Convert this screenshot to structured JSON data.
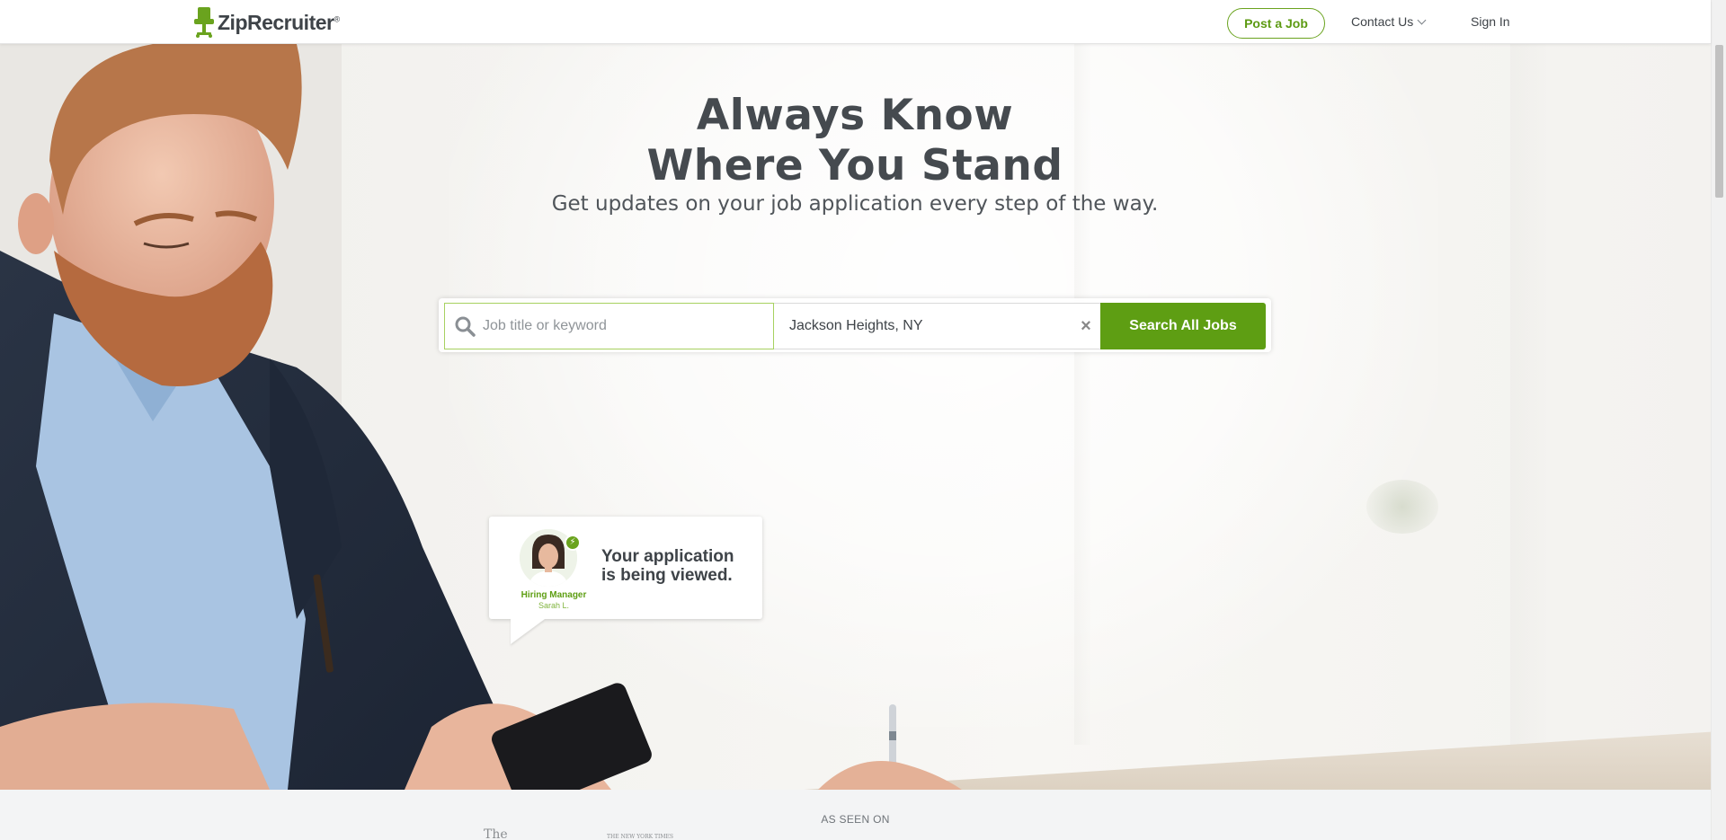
{
  "header": {
    "logo_text": "ZipRecruiter",
    "logo_mark": "®",
    "post_job_label": "Post a Job",
    "contact_label": "Contact Us",
    "sign_in_label": "Sign In"
  },
  "hero": {
    "headline_line1": "Always Know",
    "headline_line2": "Where You Stand",
    "subheadline": "Get updates on your job application every step of the way."
  },
  "search": {
    "job_placeholder": "Job title or keyword",
    "job_value": "",
    "location_value": "Jackson Heights, NY",
    "clear_glyph": "×",
    "button_label": "Search All Jobs"
  },
  "notification": {
    "role": "Hiring Manager",
    "name": "Sarah L.",
    "message_line1": "Your application",
    "message_line2": "is being viewed."
  },
  "press": {
    "label": "AS SEEN ON",
    "logo1": "The",
    "logo2": "THE NEW YORK TIMES"
  },
  "colors": {
    "brand_green": "#5e9e13",
    "text_dark": "#3e4348"
  },
  "icons": [
    "chair-logo-icon",
    "chevron-down-icon",
    "search-icon",
    "clear-icon",
    "bolt-icon"
  ]
}
